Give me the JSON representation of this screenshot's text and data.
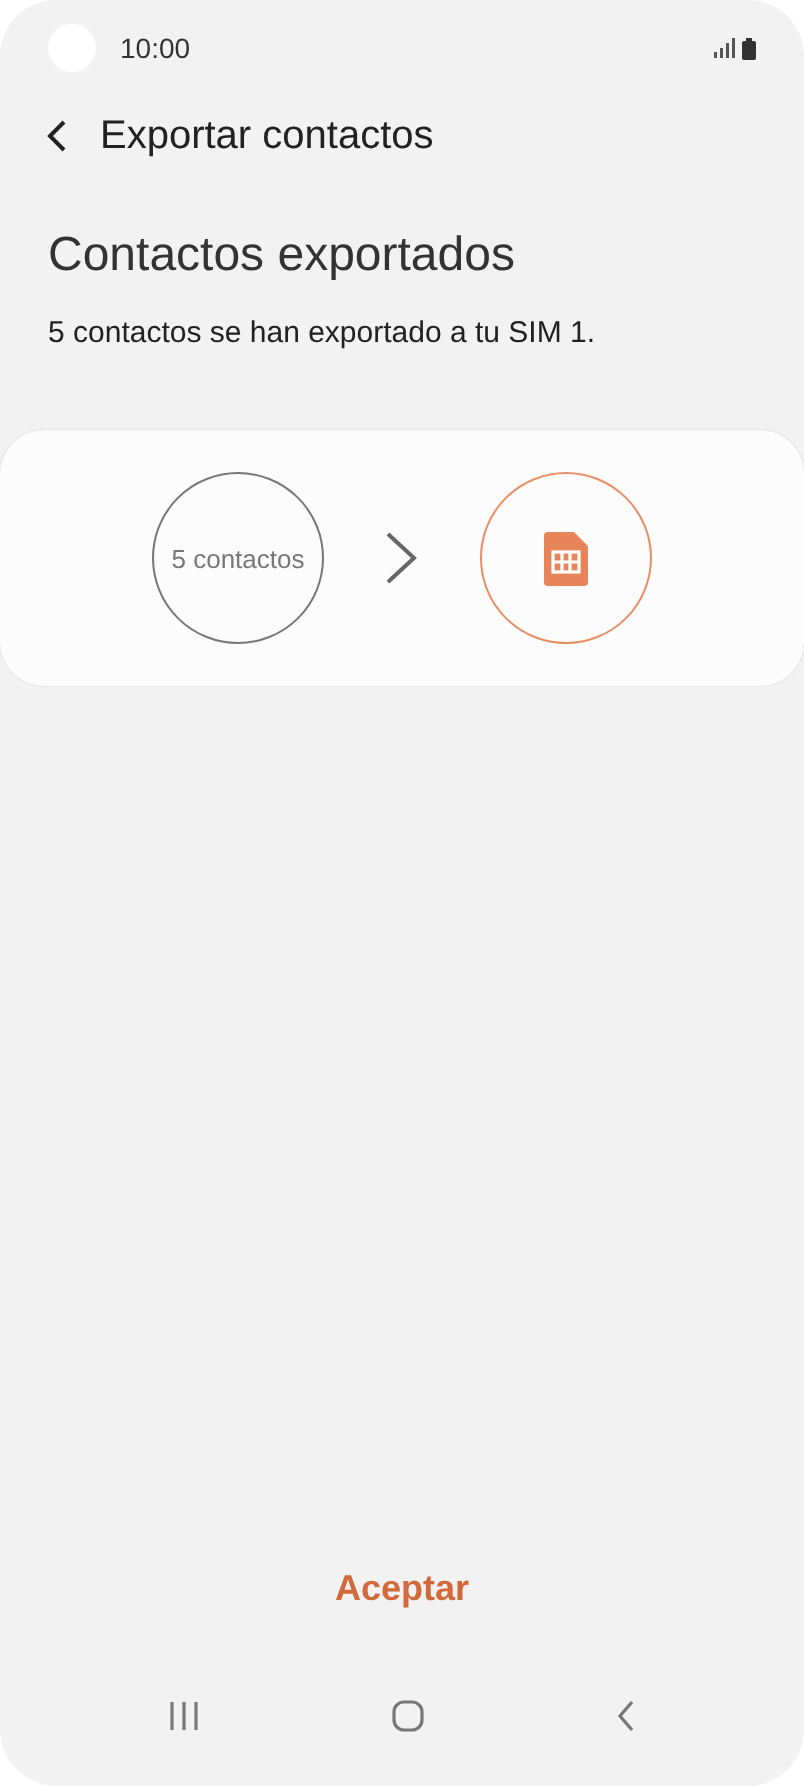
{
  "status_bar": {
    "time": "10:00"
  },
  "header": {
    "title": "Exportar contactos"
  },
  "heading": "Contactos exportados",
  "message": "5 contactos se han exportado a tu SIM 1.",
  "transfer": {
    "source_label": "5 contactos"
  },
  "button": "Aceptar"
}
